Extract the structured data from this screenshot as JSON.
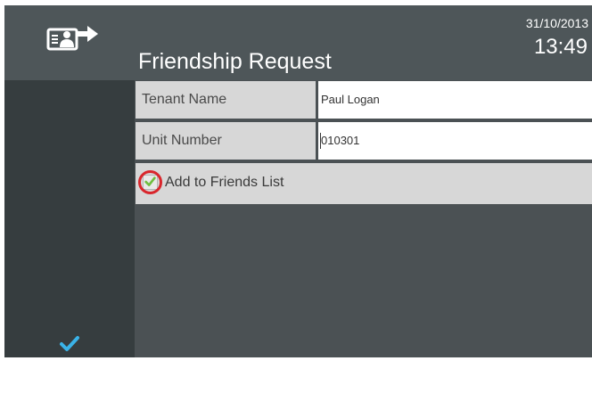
{
  "header": {
    "title": "Friendship Request",
    "date": "31/10/2013",
    "time": "13:49",
    "icon": "tenant-directory-icon"
  },
  "form": {
    "tenant_name": {
      "label": "Tenant Name",
      "value": "Paul Logan"
    },
    "unit_number": {
      "label": "Unit Number",
      "value": "010301"
    },
    "add_to_friends": {
      "label": "Add to Friends List",
      "checked": true
    }
  },
  "sidebar": {
    "confirm_icon": "checkmark-icon",
    "back_icon": "back-arrow-icon"
  },
  "colors": {
    "header_bg": "#4e5659",
    "sidebar_bg": "#363d3f",
    "content_bg": "#4b5154",
    "field_label_bg": "#d7d7d7",
    "checkmark_blue": "#3ab3e8",
    "checkbox_green": "#6fbe3f",
    "highlight_red": "#d9262c"
  }
}
